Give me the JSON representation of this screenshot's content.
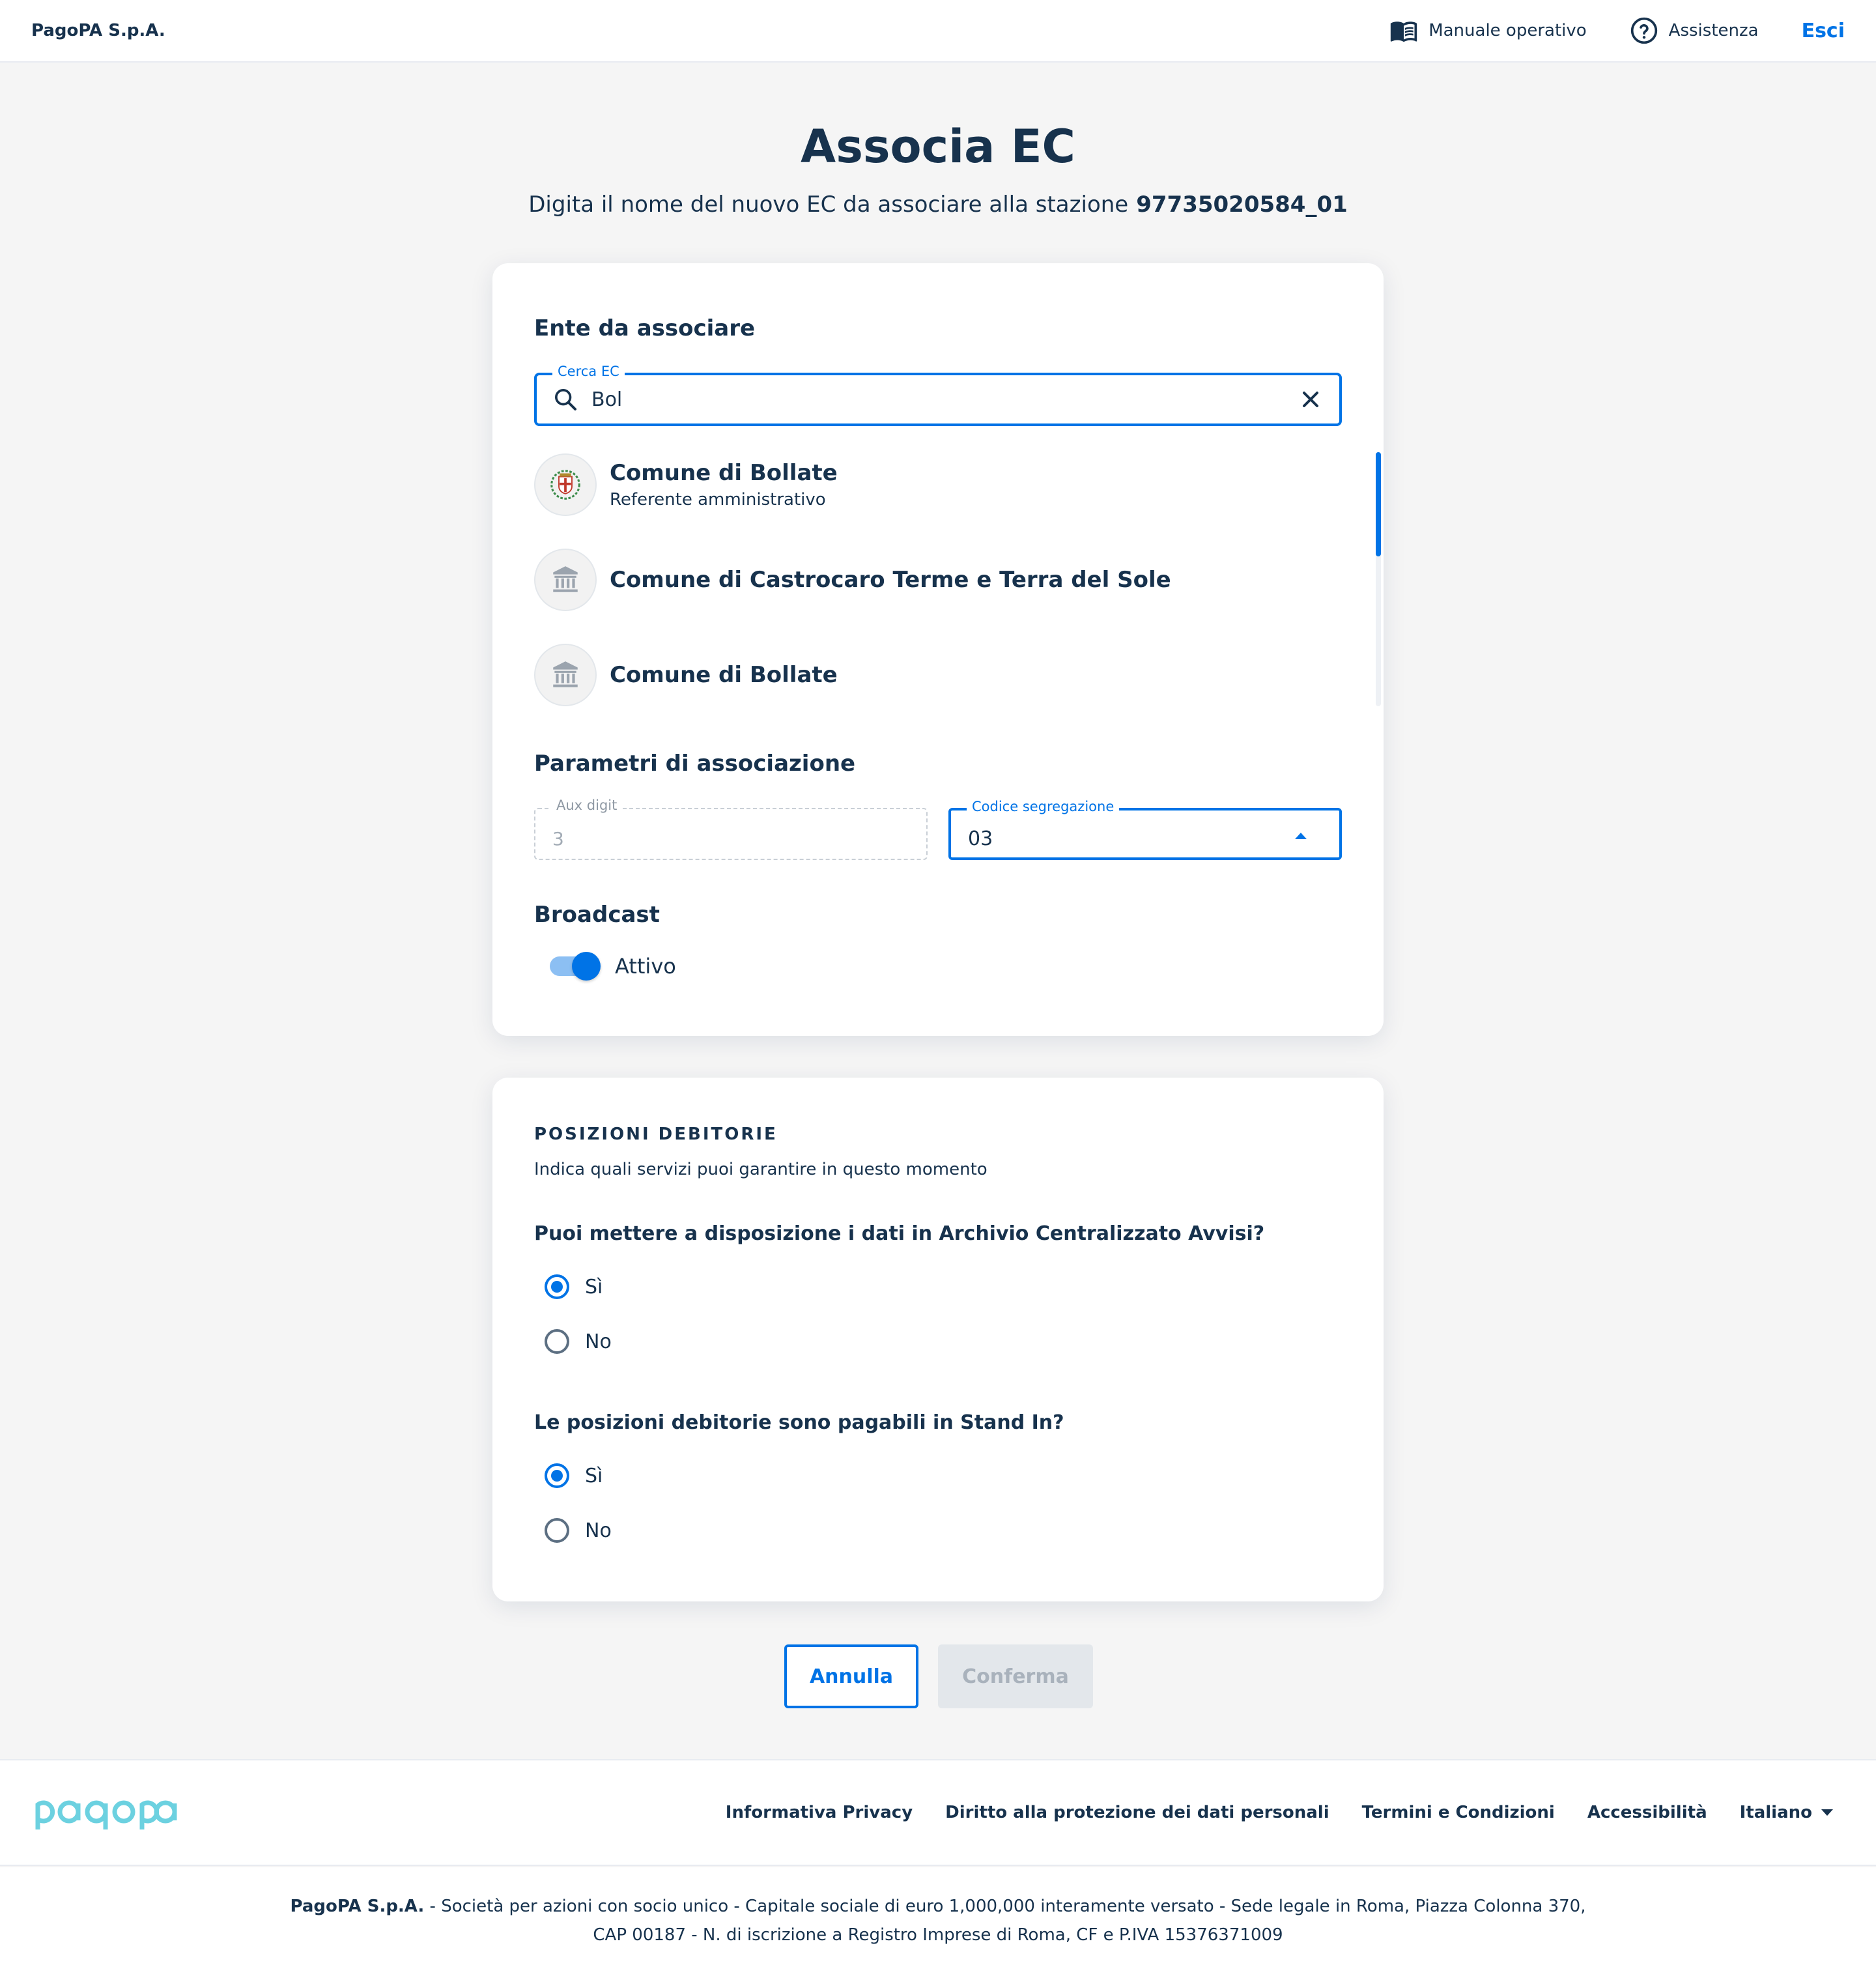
{
  "header": {
    "brand": "PagoPA S.p.A.",
    "manual_label": "Manuale operativo",
    "help_label": "Assistenza",
    "logout_label": "Esci"
  },
  "page": {
    "title": "Associa EC",
    "subtitle": "Digita il nome del nuovo EC da associare alla stazione",
    "station_code": "97735020584_01"
  },
  "ente": {
    "heading": "Ente da associare",
    "search": {
      "legend": "Cerca EC",
      "value": "Bol"
    },
    "results": [
      {
        "name": "Comune di Bollate",
        "role": "Referente amministrativo",
        "icon": "coat-of-arms-icon"
      },
      {
        "name": "Comune di Castrocaro Terme e Terra del Sole",
        "role": "",
        "icon": "institution-icon"
      },
      {
        "name": "Comune di Bollate",
        "role": "",
        "icon": "institution-icon"
      }
    ]
  },
  "params": {
    "heading": "Parametri di associazione",
    "aux_digit": {
      "legend": "Aux digit",
      "value": "3"
    },
    "segregation": {
      "legend": "Codice segregazione",
      "value": "03"
    }
  },
  "broadcast": {
    "heading": "Broadcast",
    "label": "Attivo",
    "enabled": true
  },
  "debt": {
    "overline": "POSIZIONI DEBITORIE",
    "description": "Indica quali servizi puoi garantire in questo momento",
    "q1": {
      "text": "Puoi mettere a disposizione i dati in Archivio Centralizzato Avvisi?",
      "yes": "Sì",
      "no": "No",
      "selected": "yes"
    },
    "q2": {
      "text": "Le posizioni debitorie sono pagabili in Stand In?",
      "yes": "Sì",
      "no": "No",
      "selected": "yes"
    }
  },
  "actions": {
    "cancel": "Annulla",
    "confirm": "Conferma"
  },
  "footer": {
    "links": [
      "Informativa Privacy",
      "Diritto alla protezione dei dati personali",
      "Termini e Condizioni",
      "Accessibilità"
    ],
    "language": "Italiano",
    "company": "PagoPA S.p.A.",
    "legal_line1": " - Società per azioni con socio unico - Capitale sociale di euro 1,000,000 interamente versato - Sede legale in Roma, Piazza Colonna 370,",
    "legal_line2": "CAP 00187 - N. di iscrizione a Registro Imprese di Roma, CF e P.IVA 15376371009"
  },
  "colors": {
    "primary": "#0073E6",
    "text": "#17324D",
    "background": "#F5F5F5",
    "disabled_bg": "#E3E7EB"
  }
}
